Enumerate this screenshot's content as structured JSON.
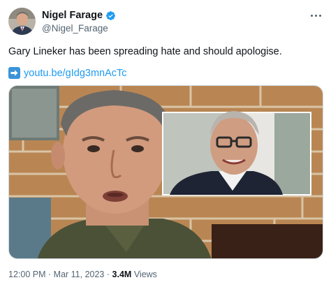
{
  "author": {
    "display_name": "Nigel Farage",
    "handle": "@Nigel_Farage",
    "verified": true,
    "verified_color": "#1d9bf0"
  },
  "tweet": {
    "text": "Gary Lineker has been spreading hate and should apologise.",
    "link_icon": "right-arrow-emoji-icon",
    "link_text": "youtu.be/gIdg3mnAcTc",
    "link_color": "#1d9bf0"
  },
  "meta": {
    "time": "12:00 PM",
    "separator1": "·",
    "date": "Mar 11, 2023",
    "separator2": "·",
    "views_count": "3.4M",
    "views_label": "Views"
  },
  "icons": {
    "more": "more-options-icon",
    "verified": "verified-badge-icon"
  }
}
